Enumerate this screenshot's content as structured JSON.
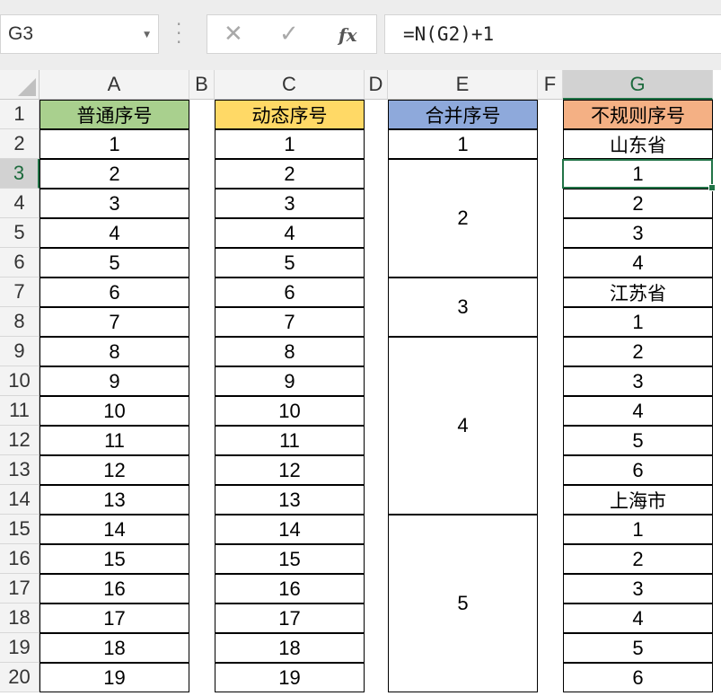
{
  "namebox": {
    "value": "G3"
  },
  "formula_bar": {
    "fx_label": "fx",
    "formula": "=N(G2)+1",
    "cancel_icon": "cancel-icon",
    "enter_icon": "enter-icon"
  },
  "columns": [
    "A",
    "B",
    "C",
    "D",
    "E",
    "F",
    "G"
  ],
  "rows": [
    "1",
    "2",
    "3",
    "4",
    "5",
    "6",
    "7",
    "8",
    "9",
    "10",
    "11",
    "12",
    "13",
    "14",
    "15",
    "16",
    "17",
    "18",
    "19",
    "20"
  ],
  "selected": {
    "column": "G",
    "row": "3"
  },
  "headers": {
    "A": {
      "label": "普通序号",
      "fill": "#a9d08e"
    },
    "C": {
      "label": "动态序号",
      "fill": "#ffd966"
    },
    "E": {
      "label": "合并序号",
      "fill": "#8ea9db"
    },
    "G": {
      "label": "不规则序号",
      "fill": "#f4b084"
    }
  },
  "col_A": [
    "1",
    "2",
    "3",
    "4",
    "5",
    "6",
    "7",
    "8",
    "9",
    "10",
    "11",
    "12",
    "13",
    "14",
    "15",
    "16",
    "17",
    "18",
    "19"
  ],
  "col_C": [
    "1",
    "2",
    "3",
    "4",
    "5",
    "6",
    "7",
    "8",
    "9",
    "10",
    "11",
    "12",
    "13",
    "14",
    "15",
    "16",
    "17",
    "18",
    "19"
  ],
  "col_E": [
    {
      "value": "1",
      "row_start": 2,
      "row_span": 1
    },
    {
      "value": "2",
      "row_start": 3,
      "row_span": 4
    },
    {
      "value": "3",
      "row_start": 7,
      "row_span": 2
    },
    {
      "value": "4",
      "row_start": 9,
      "row_span": 6
    },
    {
      "value": "5",
      "row_start": 15,
      "row_span": 6
    }
  ],
  "col_G": [
    "山东省",
    "1",
    "2",
    "3",
    "4",
    "江苏省",
    "1",
    "2",
    "3",
    "4",
    "5",
    "6",
    "上海市",
    "1",
    "2",
    "3",
    "4",
    "5",
    "6"
  ]
}
